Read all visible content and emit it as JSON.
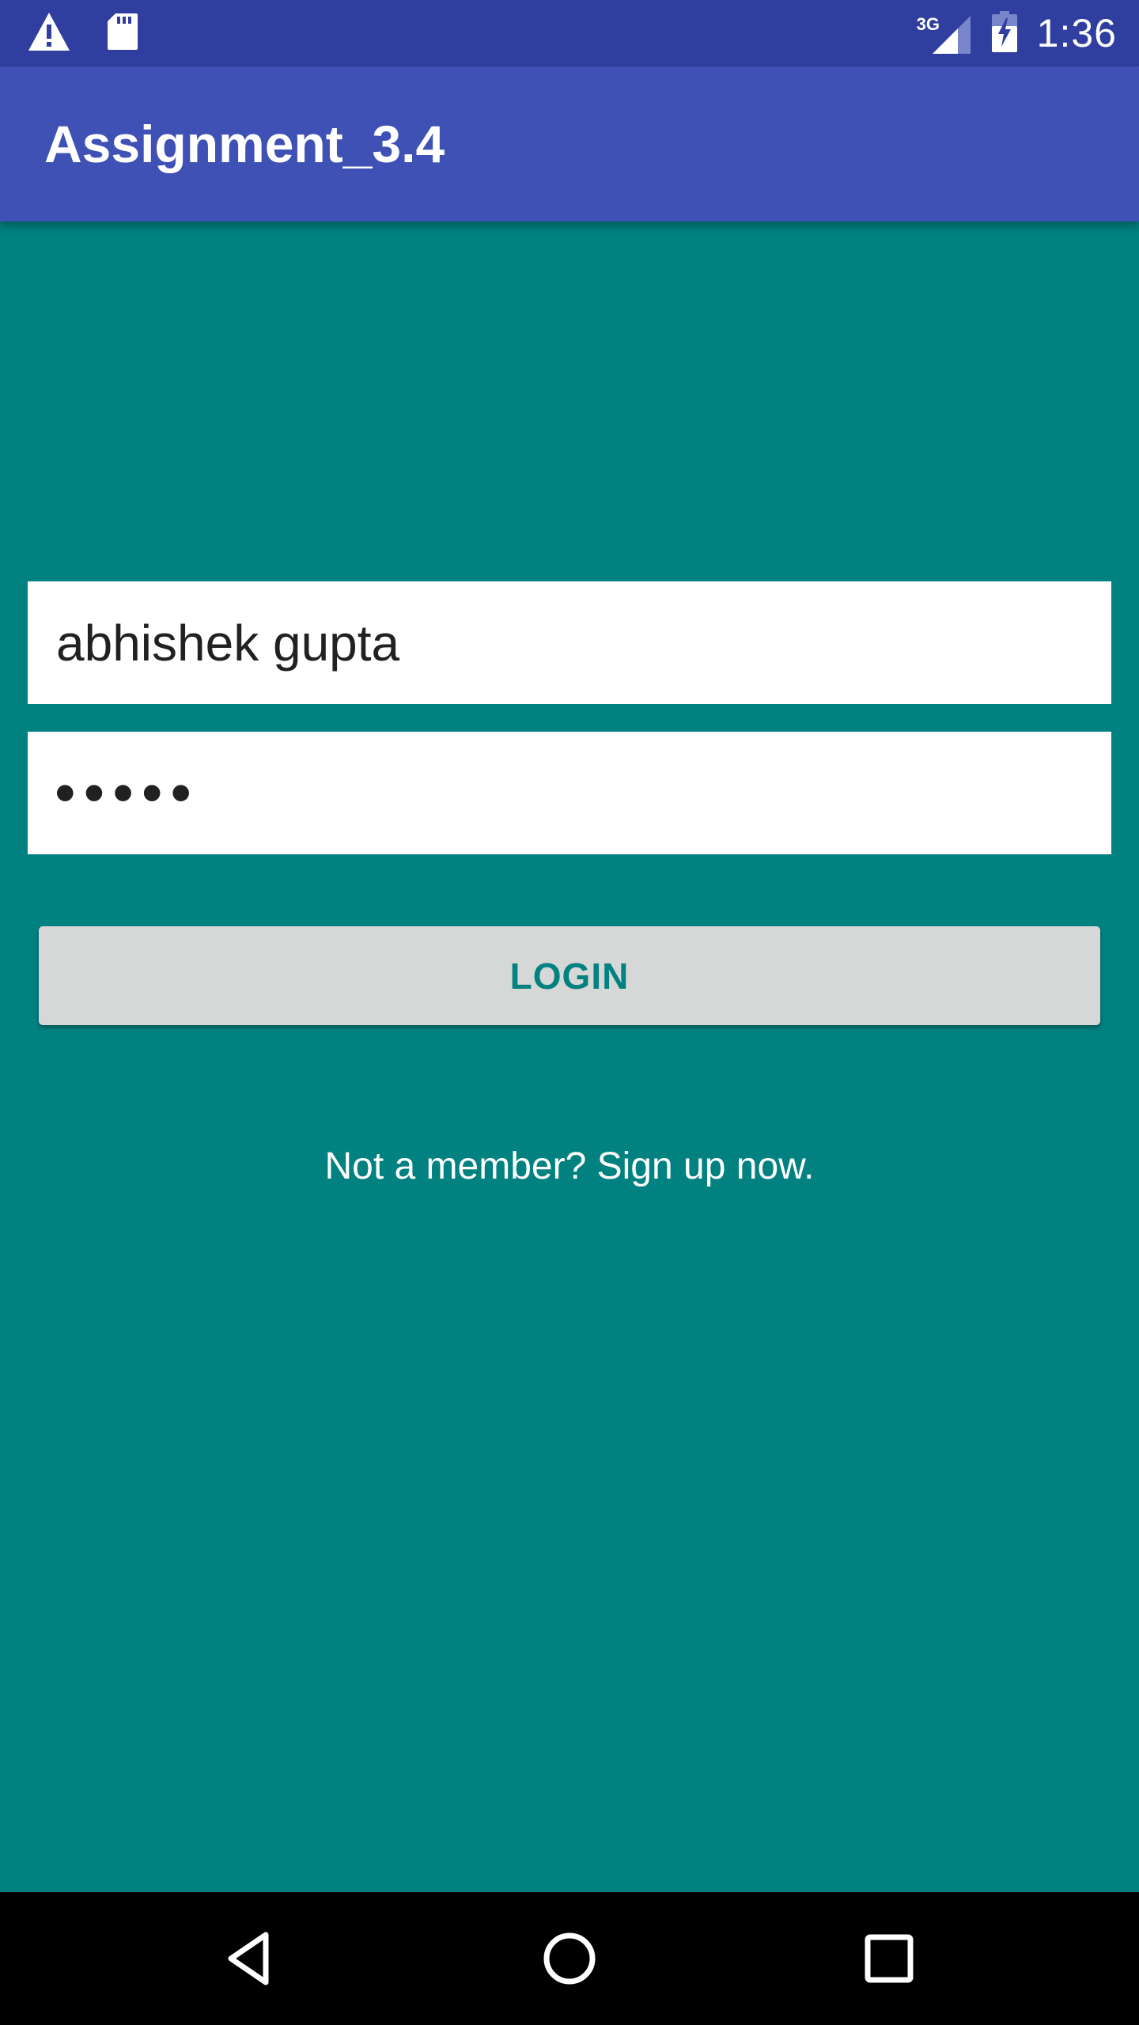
{
  "status_bar": {
    "time": "1:36",
    "network": "3G",
    "icons": [
      "warning-icon",
      "sd-card-icon",
      "signal-3g-icon",
      "battery-charging-icon"
    ]
  },
  "app_bar": {
    "title": "Assignment_3.4",
    "color": "#3F51B5"
  },
  "form": {
    "username_value": "abhishek gupta",
    "password_masked": "•••••",
    "login_label": "LOGIN",
    "signup_text": "Not a member? Sign up now."
  },
  "nav_bar": {
    "icons": [
      "back-icon",
      "home-icon",
      "recents-icon"
    ]
  },
  "colors": {
    "status_bar": "#303F9F",
    "background": "#018180",
    "button": "#D6D7D7",
    "button_text": "#018180"
  }
}
